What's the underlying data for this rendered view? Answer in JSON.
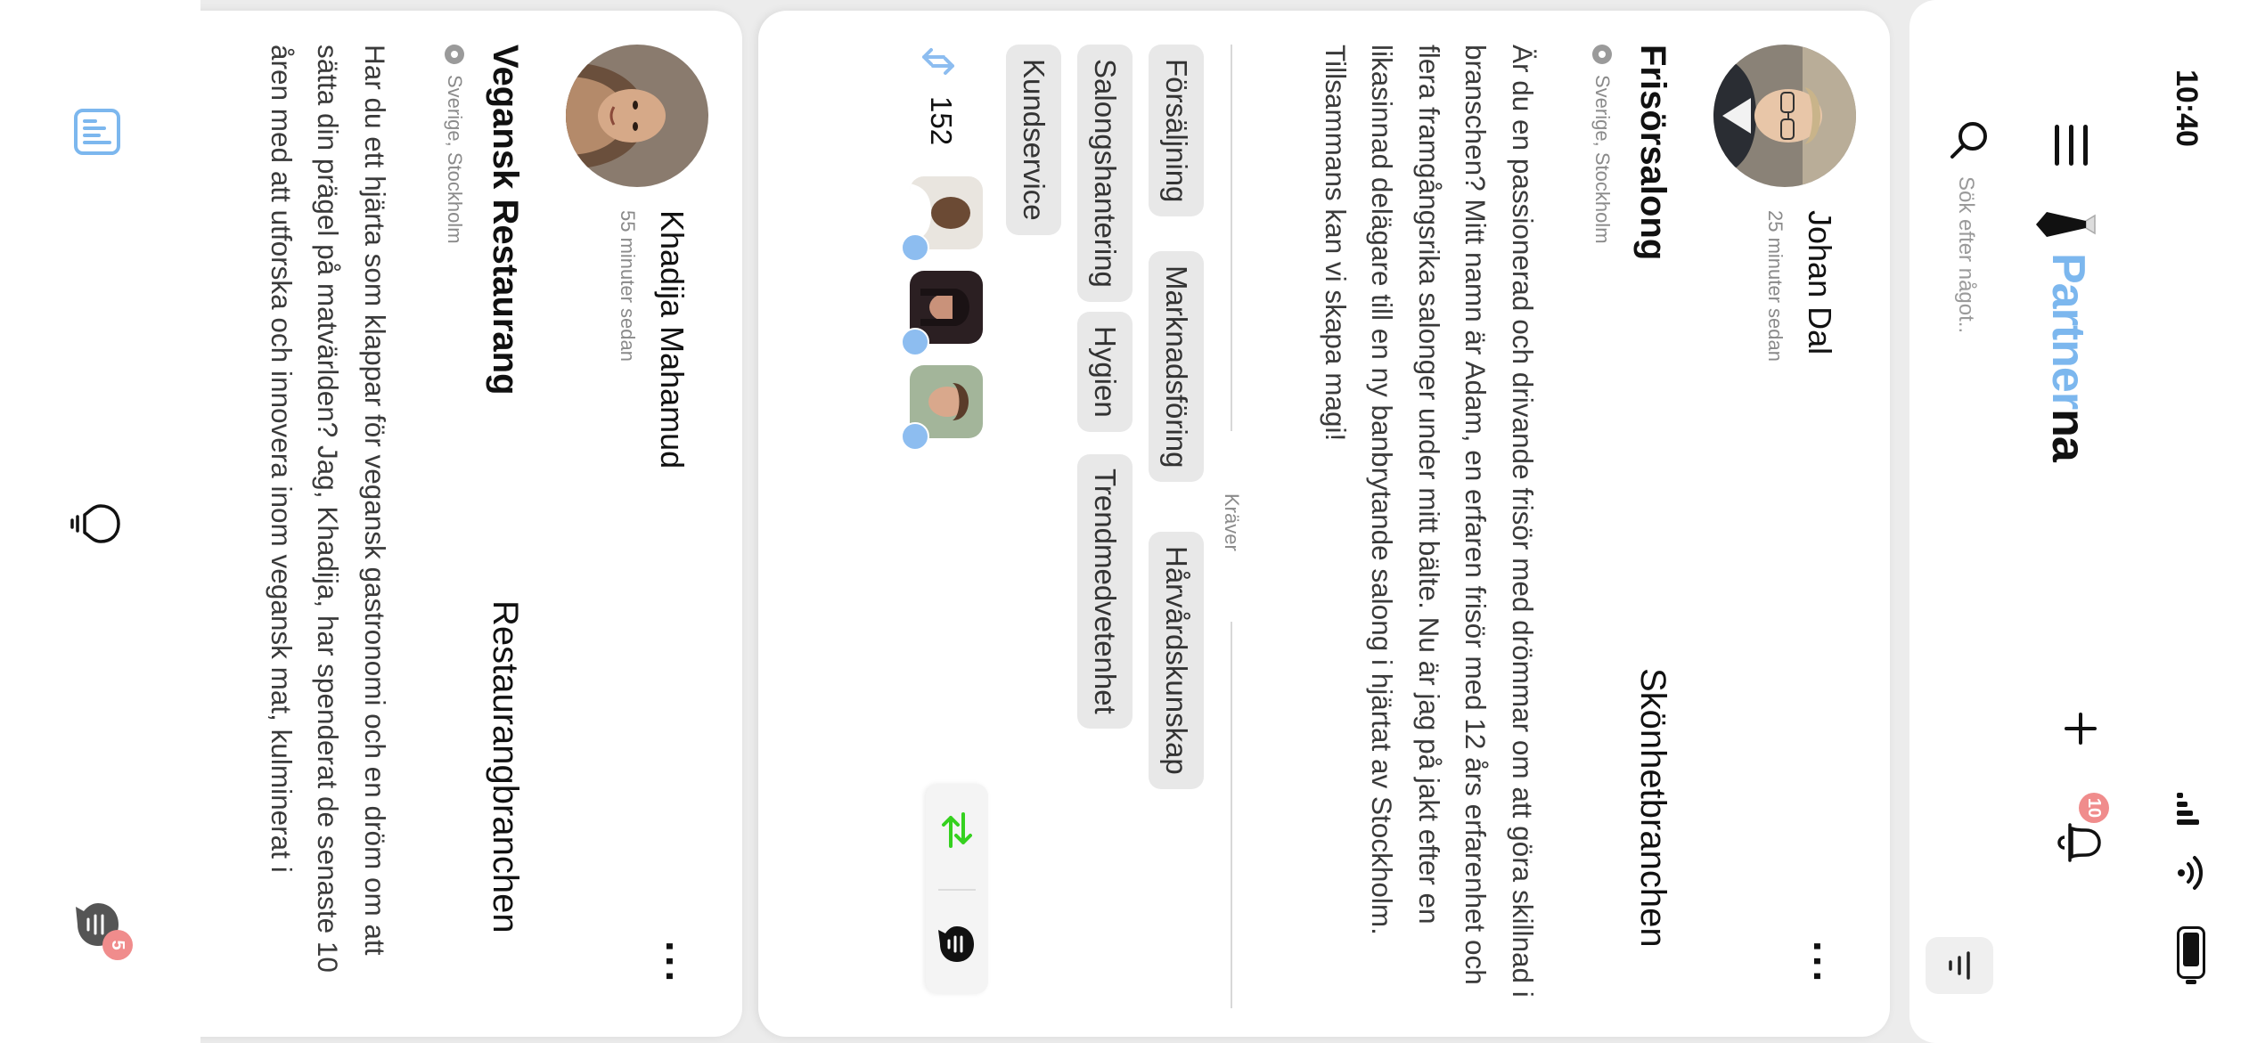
{
  "status_bar": {
    "time": "10:40"
  },
  "header": {
    "logo": {
      "part1": "Partner",
      "part2": "na"
    },
    "search": {
      "placeholder": "Sök efter något.."
    },
    "notifications": {
      "count": "10"
    }
  },
  "posts": [
    {
      "author": "Johan Dal",
      "time_ago": "25 minuter sedan",
      "title": "Frisörsalong",
      "industry": "Skönhetbranchen",
      "location": "Sverige, Stockholm",
      "description": "Är du en passionerad och drivande frisör med drömmar om att göra skillnad i branschen? Mitt namn är Adam, en erfaren frisör med 12 års erfarenhet och flera framgångsrika salonger under mitt bälte. Nu är jag på jakt efter en likasinnad delägare till en ny banbrytande salong i hjärtat av Stockholm. Tillsammans kan vi skapa magi!",
      "requires_label": "Kräver",
      "skills": [
        "Försäljning",
        "Marknadsföring",
        "Hårvårdskunskap",
        "Salongshantering",
        "Hygien",
        "Trendmedvetenhet",
        "Kundservice"
      ],
      "interest_count": "152"
    },
    {
      "author": "Khadija Mahamud",
      "time_ago": "55 minuter sedan",
      "title": "Vegansk Restaurang",
      "industry": "Restaurangbranchen",
      "location": "Sverige, Stockholm",
      "description": "Har du ett hjärta som klappar för vegansk gastronomi och en dröm om att sätta din prägel på matvärlden? Jag, Khadija, har spenderat de senaste 10 åren med att utforska och innovera inom vegansk mat, kulminerat i"
    }
  ],
  "bottom_nav": {
    "messages_badge": "5"
  },
  "colors": {
    "accent": "#7cb7ee",
    "badge": "#f08c8c",
    "swap_green": "#35d11f"
  }
}
